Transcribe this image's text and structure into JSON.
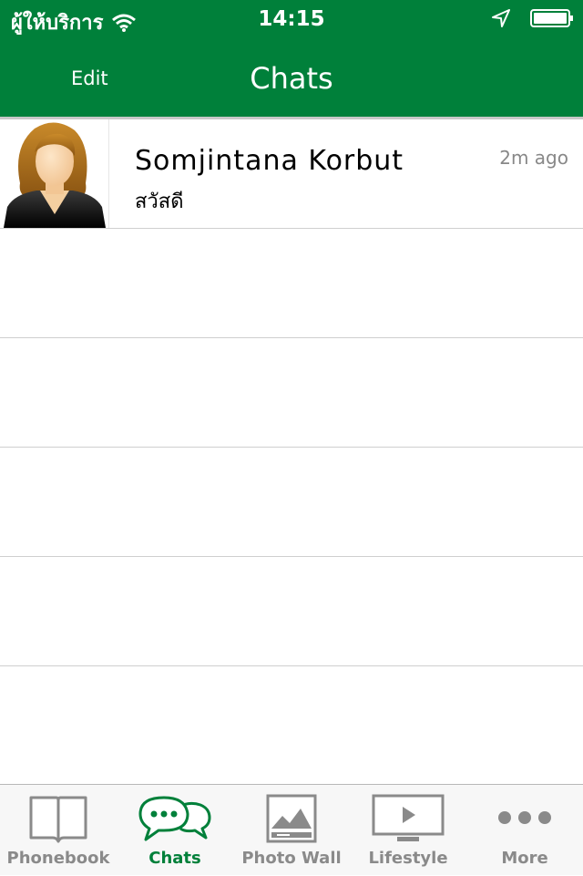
{
  "status_bar": {
    "carrier": "ผู้ให้บริการ",
    "time": "14:15"
  },
  "nav": {
    "edit_label": "Edit",
    "title": "Chats"
  },
  "chats": [
    {
      "name": "Somjintana Korbut",
      "message": "สวัสดี",
      "time_ago": "2m ago"
    }
  ],
  "tabs": [
    {
      "label": "Phonebook",
      "icon": "book-icon"
    },
    {
      "label": "Chats",
      "icon": "chat-bubbles-icon",
      "active": true
    },
    {
      "label": "Photo  Wall",
      "icon": "photo-icon"
    },
    {
      "label": "Lifestyle",
      "icon": "tv-play-icon"
    },
    {
      "label": "More",
      "icon": "more-dots-icon"
    }
  ],
  "colors": {
    "brand_green": "#00803a",
    "inactive_gray": "#8a8a8a"
  }
}
